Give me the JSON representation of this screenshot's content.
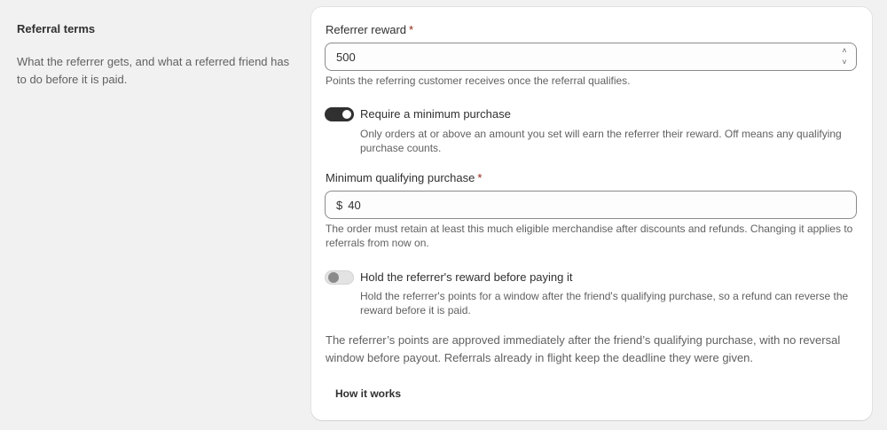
{
  "section": {
    "title": "Referral terms",
    "description": "What the referrer gets, and what a referred friend has to do before it is paid."
  },
  "referrer_reward": {
    "label": "Referrer reward",
    "required_mark": "*",
    "value": "500",
    "help": "Points the referring customer receives once the referral qualifies."
  },
  "min_purchase_toggle": {
    "label": "Require a minimum purchase",
    "state": "on",
    "help": "Only orders at or above an amount you set will earn the referrer their reward. Off means any qualifying purchase counts."
  },
  "min_qualifying_purchase": {
    "label": "Minimum qualifying purchase",
    "required_mark": "*",
    "prefix": "$",
    "value": "40",
    "help": "The order must retain at least this much eligible merchandise after discounts and refunds. Changing it applies to referrals from now on."
  },
  "hold_toggle": {
    "label": "Hold the referrer's reward before paying it",
    "state": "off",
    "help": "Hold the referrer's points for a window after the friend's qualifying purchase, so a refund can reverse the reward before it is paid."
  },
  "summary": "The referrer’s points are approved immediately after the friend’s qualifying purchase, with no reversal window before payout. Referrals already in flight keep the deadline they were given.",
  "how_it_works_label": "How it works",
  "icons": {
    "stepper_up": "chevron-up-icon",
    "stepper_down": "chevron-down-icon"
  },
  "colors": {
    "background": "#f1f1f1",
    "card": "#ffffff",
    "toggle_on": "#303030",
    "toggle_off": "#e3e3e3",
    "required": "#8e1f0b"
  }
}
